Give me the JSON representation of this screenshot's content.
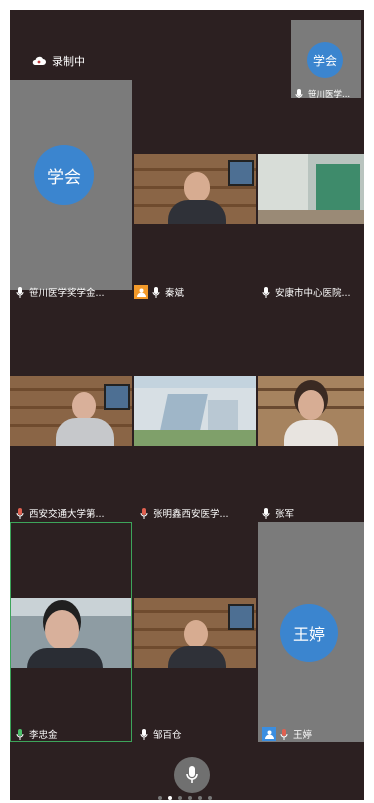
{
  "recording": {
    "text": "录制中"
  },
  "self_tile": {
    "avatar_text": "学会",
    "name": "笹川医学..."
  },
  "left_tile": {
    "avatar_text": "学会",
    "name": "笹川医学奖学金..."
  },
  "row1": [
    {
      "name": "秦斌"
    },
    {
      "name": "安康市中心医院..."
    }
  ],
  "row2": [
    {
      "name": "西安交通大学第..."
    },
    {
      "name": "张明鑫西安医学..."
    },
    {
      "name": "张军"
    }
  ],
  "row3": [
    {
      "name": "李忠金"
    },
    {
      "name": "邹百仓"
    },
    {
      "avatar_text": "王婷",
      "name": "王婷"
    }
  ],
  "pagination": {
    "count": 6,
    "active_index": 1
  }
}
